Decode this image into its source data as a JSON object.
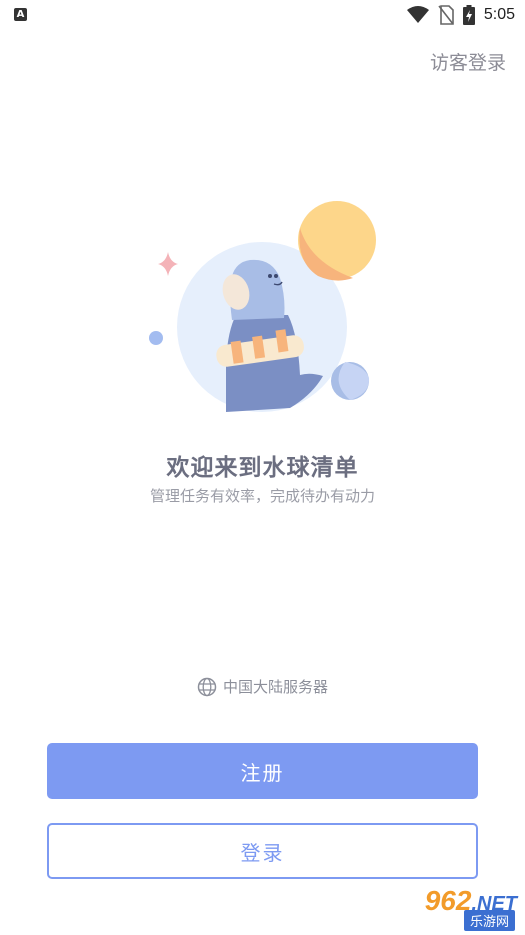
{
  "status_bar": {
    "app_icon": "A",
    "time": "5:05",
    "icons": [
      "wifi-icon",
      "no-sim-icon",
      "battery-charging-icon"
    ]
  },
  "header": {
    "guest_login": "访客登录"
  },
  "welcome": {
    "title": "欢迎来到水球清单",
    "subtitle": "管理任务有效率，完成待办有动力"
  },
  "server": {
    "icon": "globe-icon",
    "label": "中国大陆服务器"
  },
  "buttons": {
    "register": "注册",
    "login": "登录"
  },
  "watermark": {
    "number": "962",
    "suffix": ".NET",
    "site": "乐游网"
  },
  "colors": {
    "accent": "#7d9af2",
    "text_primary": "#6b6e80",
    "text_secondary": "#9a9ca6",
    "illustration_circle": "#e6effc",
    "moon_yellow": "#fdd68a",
    "moon_orange": "#f7b47c",
    "seal_blue": "#a8bde6",
    "seal_body": "#7b8fc4"
  }
}
